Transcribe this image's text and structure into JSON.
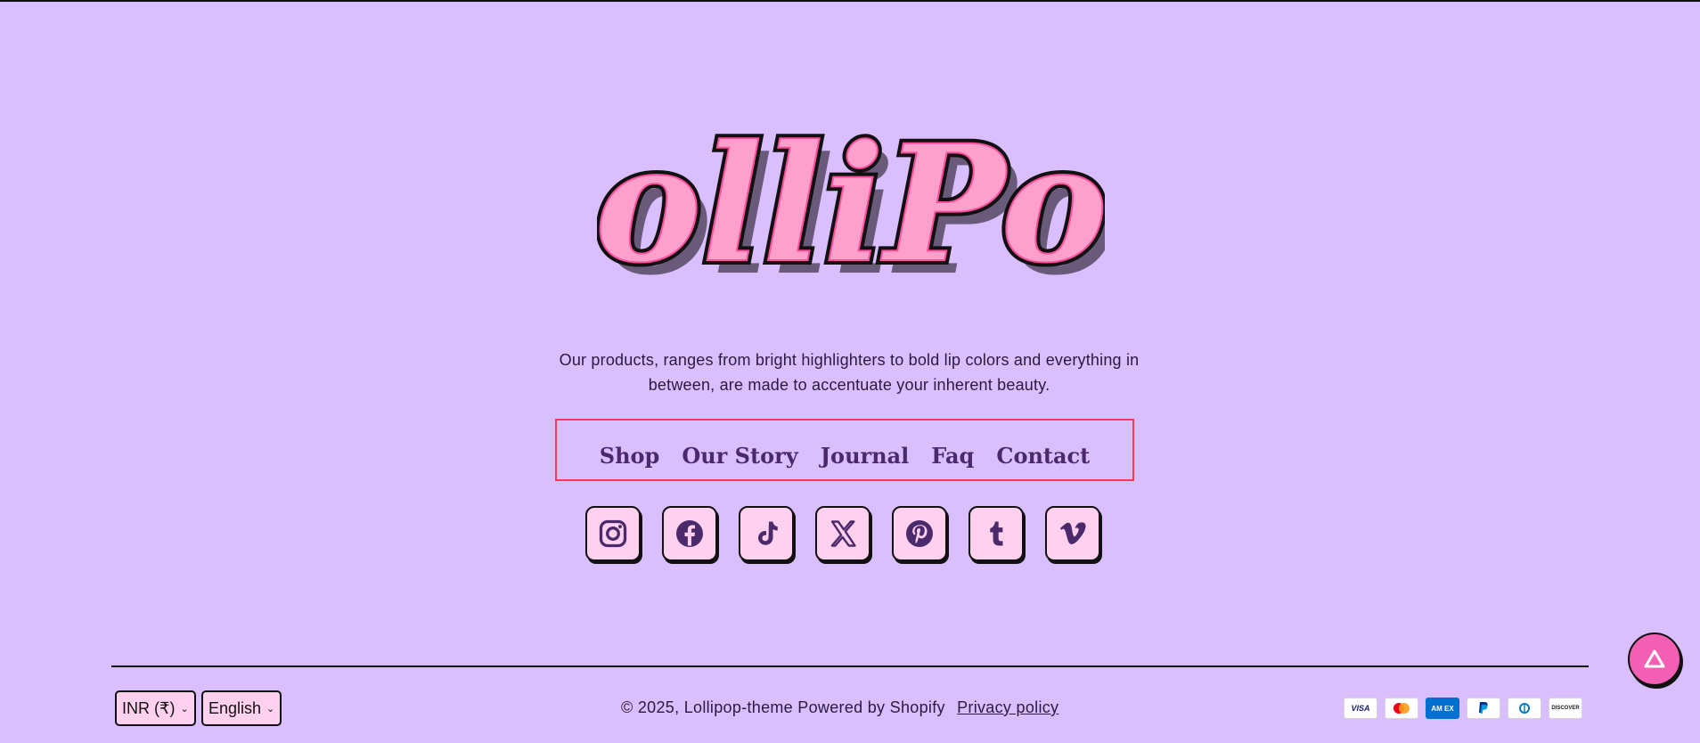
{
  "brand": {
    "logo_text": "LolliPop",
    "tagline": "Our products, ranges from bright highlighters to bold lip colors and everything in between, are made to accentuate your inherent beauty."
  },
  "nav": {
    "items": [
      {
        "label": "Shop"
      },
      {
        "label": "Our Story"
      },
      {
        "label": "Journal"
      },
      {
        "label": "Faq"
      },
      {
        "label": "Contact"
      }
    ]
  },
  "socials": [
    "instagram-icon",
    "facebook-icon",
    "tiktok-icon",
    "x-icon",
    "pinterest-icon",
    "tumblr-icon",
    "vimeo-icon"
  ],
  "footer": {
    "currency": "INR (₹)",
    "language": "English",
    "copyright": "© 2025, Lollipop-theme",
    "powered_by": "Powered by Shopify",
    "privacy": "Privacy policy"
  },
  "payments": {
    "visa": "VISA",
    "amex": "AM EX",
    "discover": "DISCOVER"
  },
  "colors": {
    "background": "#d9bfff",
    "accent_pink": "#f45fb6",
    "nav_text": "#4a2a6b",
    "tile_pink": "#ffd1ef",
    "highlight_border": "#ef3e4a"
  }
}
